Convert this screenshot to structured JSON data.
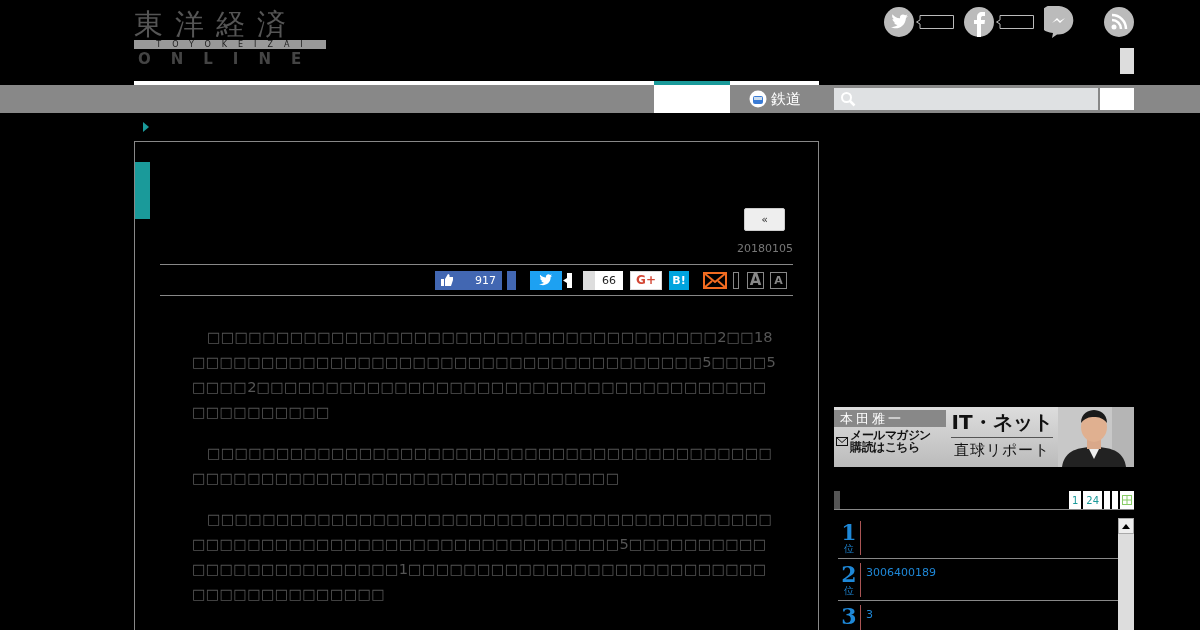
{
  "logo": {
    "title": "東洋経済",
    "subtitle": "TOYOKEIZAI",
    "tagline": "ONLINE"
  },
  "nav": {
    "items": [
      {
        "kind": "blank",
        "selected": true
      },
      {
        "kind": "icon",
        "label": "鉄道",
        "selected": false
      }
    ]
  },
  "article": {
    "back_button": "«",
    "date": "20180105",
    "share": {
      "likes": "917",
      "bookmarks": "66",
      "google_plus": "G+",
      "hatena": "B!",
      "font_large": "A",
      "font_small": "A"
    },
    "paragraphs": [
      "　□□□□□□□□□□□□□□□□□□□□□□□□□□□□□□□□□□□□□2□□18□□□□□□□□□□□□□□□□□□□□□□□□□□□□□□□□□□□□□5□□□□5□□□□2□□□□□□□□□□□□□□□□□□□□□□□□□□□□□□□□□□□□□□□□□□□□□□□",
      "　□□□□□□□□□□□□□□□□□□□□□□□□□□□□□□□□□□□□□□□□□□□□□□□□□□□□□□□□□□□□□□□□□□□□□□□□",
      "　□□□□□□□□□□□□□□□□□□□□□□□□□□□□□□□□□□□□□□□□□□□□□□□□□□□□□□□□□□□□□□□□□□□□□□□□5□□□□□□□□□□□□□□□□□□□□□□□□□1□□□□□□□□□□□□□□□□□□□□□□□□□□□□□□□□□□□□□□□□"
    ]
  },
  "banner": {
    "name": "本田雅一",
    "mail_line1": "メールマガジン",
    "mail_line2": "購読はこちら",
    "title": "IT・ネット",
    "subtitle": "直球リポート"
  },
  "ranking": {
    "tabs": [
      {
        "label": "1"
      },
      {
        "label": "24"
      }
    ],
    "items": [
      {
        "rank": "1",
        "unit": "位"
      },
      {
        "rank": "2",
        "unit": "位",
        "title": "3006400189"
      },
      {
        "rank": "3",
        "title": "3"
      }
    ]
  }
}
